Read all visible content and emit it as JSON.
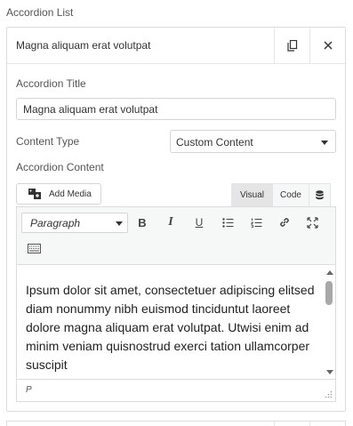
{
  "section": {
    "title": "Accordion List"
  },
  "item": {
    "header_title": "Magna aliquam erat volutpat",
    "title_label": "Accordion Title",
    "title_value": "Magna aliquam erat volutpat",
    "content_type_label": "Content Type",
    "content_type_value": "Custom Content",
    "content_label": "Accordion Content"
  },
  "editor": {
    "add_media": "Add Media",
    "tabs": {
      "visual": "Visual",
      "code": "Code"
    },
    "format": "Paragraph",
    "body": "Ipsum dolor sit amet, consectetuer adipiscing elitsed diam nonummy nibh euismod tinciduntut laoreet dolore magna aliquam erat volutpat. Utwisi enim ad minim veniam quisnostrud exerci tation ullamcorper suscipit",
    "path": "P"
  },
  "icons": {
    "copy": "copy-icon",
    "close": "close-icon",
    "media": "add-media-icon",
    "database": "database-icon",
    "bold": "bold-icon",
    "italic": "italic-icon",
    "underline": "underline-icon",
    "bullet_list": "bullet-list-icon",
    "numbered_list": "numbered-list-icon",
    "link": "link-icon",
    "fullscreen": "fullscreen-icon",
    "toolbar_toggle": "keyboard-icon"
  }
}
